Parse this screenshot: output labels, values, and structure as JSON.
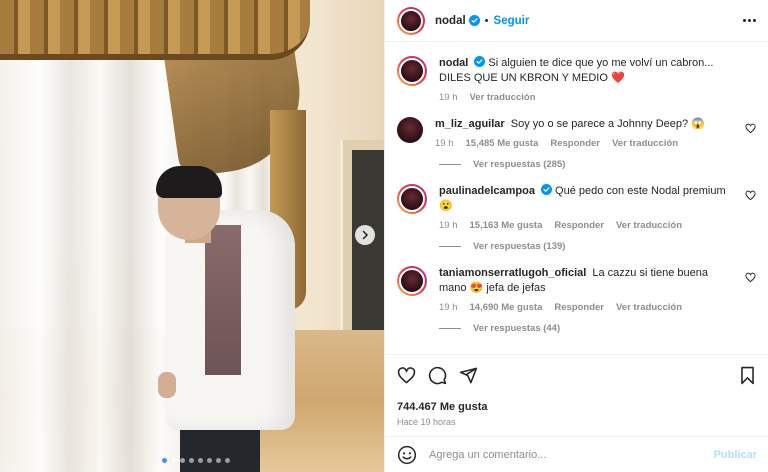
{
  "post": {
    "username": "nodal",
    "follow_label": "Seguir",
    "separator": "•",
    "caption_line1": "Si alguien te dice que yo me volví un cabron...",
    "caption_line2": "DILES QUE UN KBRON Y MEDIO",
    "caption_emoji": "❤️",
    "caption_time": "19 h",
    "see_translation": "Ver traducción",
    "likes": "744.467 Me gusta",
    "posted_ago": "Hace 19 horas",
    "carousel_total": 8,
    "carousel_active": 1
  },
  "comments": [
    {
      "user": "m_liz_aguilar",
      "text": "Soy yo o se parece a Johnny Deep? 😱",
      "time": "19 h",
      "likes": "15,485 Me gusta",
      "reply": "Responder",
      "translate": "Ver traducción",
      "view_replies": "Ver respuestas (285)"
    },
    {
      "user": "paulinadelcampoa",
      "verified": true,
      "text": "Qué pedo con este Nodal premium 😮",
      "time": "19 h",
      "likes": "15,163 Me gusta",
      "reply": "Responder",
      "translate": "Ver traducción",
      "view_replies": "Ver respuestas (139)"
    },
    {
      "user": "taniamonserratlugoh_oficial",
      "text": "La cazzu si tiene buena mano 😍 jefa de jefas",
      "time": "19 h",
      "likes": "14,690 Me gusta",
      "reply": "Responder",
      "translate": "Ver traducción",
      "view_replies": "Ver respuestas (44)"
    }
  ],
  "add_comment": {
    "placeholder": "Agrega un comentario...",
    "publish_label": "Publicar"
  },
  "colors": {
    "accent": "#0095f6",
    "publish_disabled": "#b2dffc",
    "muted": "#8e8e8e",
    "text": "#262626",
    "like_heart": "#ed4956"
  },
  "icons": [
    "chevron-right-icon",
    "verified-badge-icon",
    "more-options-icon",
    "heart-icon",
    "comment-icon",
    "share-icon",
    "bookmark-icon",
    "emoji-icon"
  ]
}
